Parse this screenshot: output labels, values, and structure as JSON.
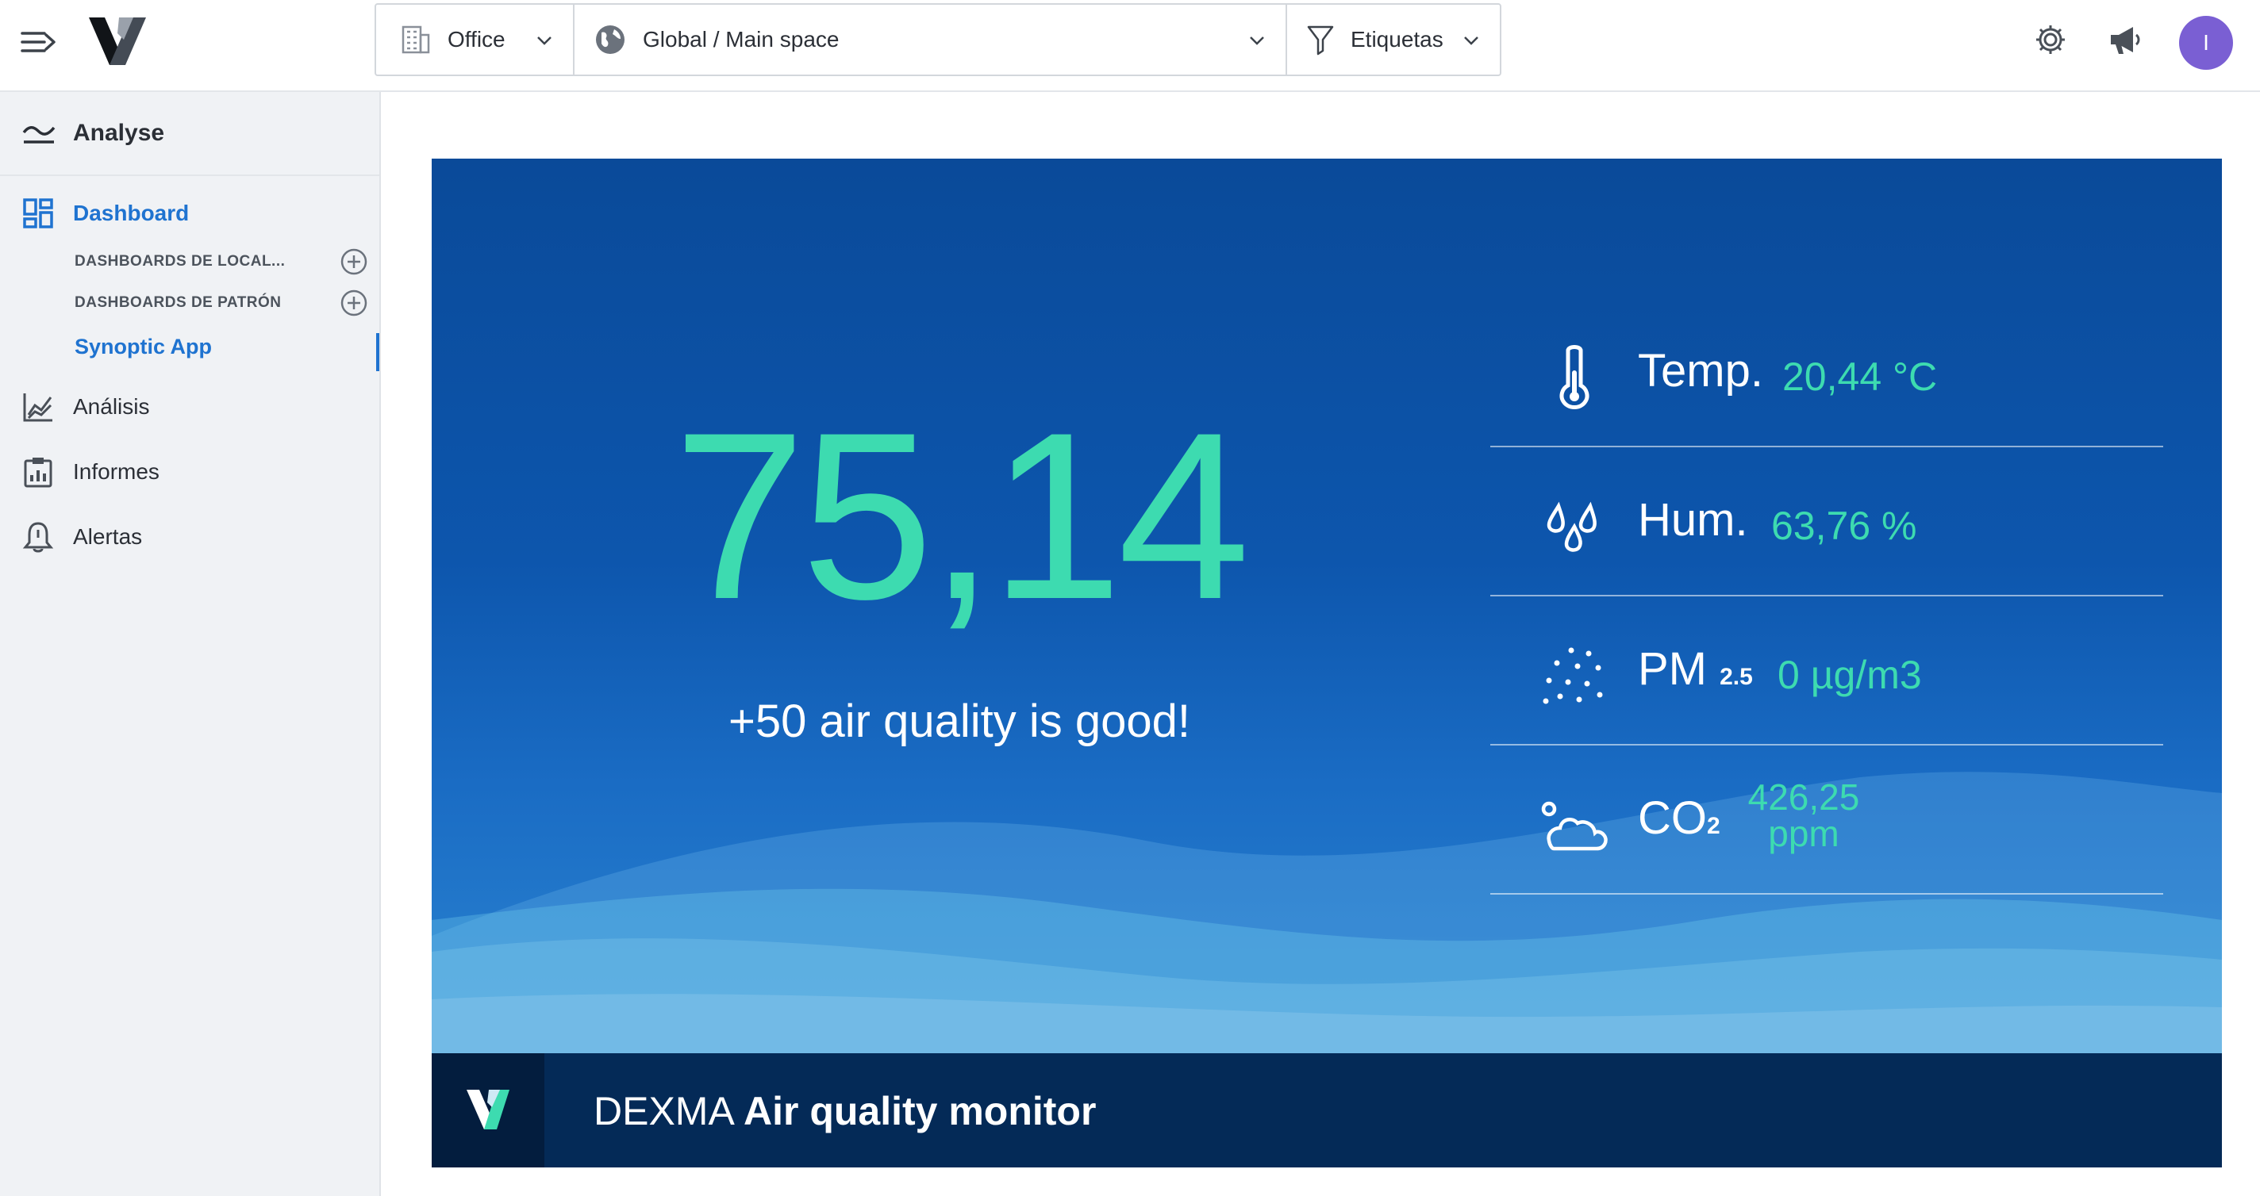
{
  "header": {
    "office_label": "Office",
    "space_label": "Global / Main space",
    "tags_label": "Etiquetas",
    "avatar_initial": "I"
  },
  "sidebar": {
    "section_title": "Analyse",
    "items": [
      {
        "label": "Dashboard"
      },
      {
        "label": "Análisis"
      },
      {
        "label": "Informes"
      },
      {
        "label": "Alertas"
      }
    ],
    "sub_items": [
      {
        "label": "DASHBOARDS DE LOCAL..."
      },
      {
        "label": "DASHBOARDS DE PATRÓN"
      }
    ],
    "active_link": "Synoptic App"
  },
  "widget": {
    "main_value": "75,14",
    "message": "+50 air quality is good!",
    "metrics": [
      {
        "label": "Temp.",
        "value": "20,44 °C"
      },
      {
        "label": "Hum.",
        "value": "63,76 %"
      },
      {
        "label": "PM",
        "sub": "2.5",
        "value": "0 µg/m3"
      },
      {
        "label": "CO",
        "sub": "2",
        "value_line1": "426,25",
        "value_line2": "ppm"
      }
    ],
    "footer": {
      "brand": "DEXMA",
      "title": "Air quality monitor"
    }
  },
  "colors": {
    "accent": "#1f73d0",
    "value_green": "#3ddbb0",
    "widget_blue": "#0d56ad",
    "footer_navy": "#042a57",
    "avatar": "#7a5fd3"
  }
}
